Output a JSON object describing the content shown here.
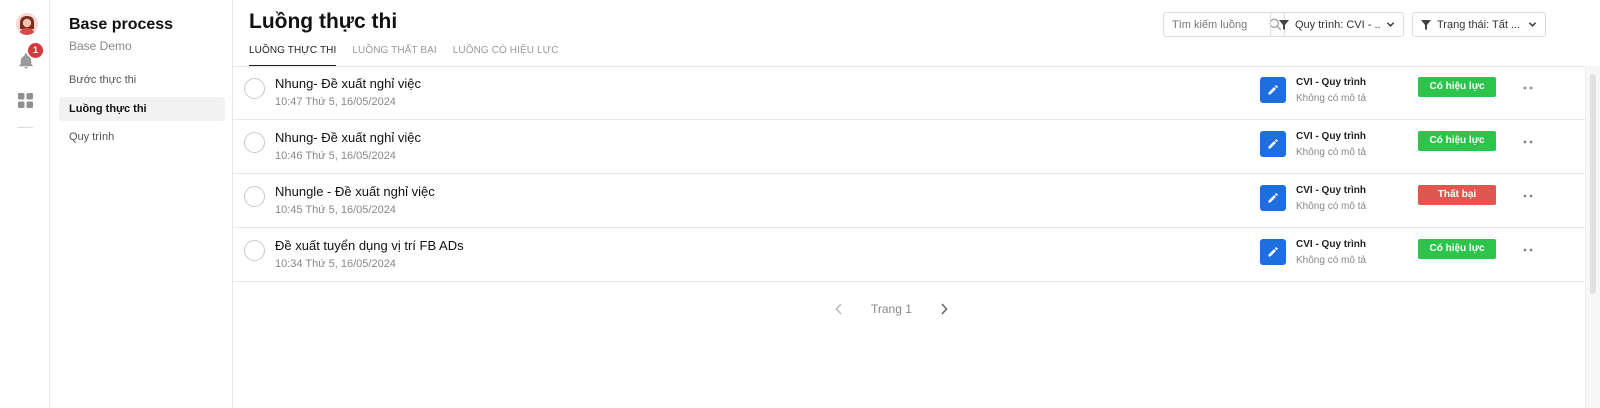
{
  "rail": {
    "notification_count": "1",
    "colors": {
      "badge": "#d9363e"
    }
  },
  "sidebar": {
    "title": "Base process",
    "subtitle": "Base Demo",
    "items": [
      {
        "label": "Bước thực thi",
        "active": false
      },
      {
        "label": "Luồng thực thi",
        "active": true
      },
      {
        "label": "Quy trình",
        "active": false
      }
    ]
  },
  "main": {
    "title": "Luồng thực thi",
    "tabs": [
      {
        "label": "LUỒNG THỰC THI",
        "active": true
      },
      {
        "label": "LUỒNG THẤT BẠI",
        "active": false
      },
      {
        "label": "LUỒNG CÓ HIỆU LỰC",
        "active": false
      }
    ],
    "search": {
      "placeholder": "Tìm kiếm luồng",
      "value": ""
    },
    "filters": {
      "process": "Quy trình: CVI - ...",
      "status": "Trạng thái: Tất ..."
    },
    "rows": [
      {
        "title": "Nhung- Đề xuất nghỉ việc",
        "time": "10:47 Thứ 5, 16/05/2024",
        "process": "CVI - Quy trình",
        "description": "Không có mô tả",
        "status": "Có hiệu lực",
        "status_type": "ok"
      },
      {
        "title": "Nhung- Đề xuất nghỉ việc",
        "time": "10:46 Thứ 5, 16/05/2024",
        "process": "CVI - Quy trình",
        "description": "Không có mô tả",
        "status": "Có hiệu lực",
        "status_type": "ok"
      },
      {
        "title": "Nhungle - Đề xuất nghỉ việc",
        "time": "10:45 Thứ 5, 16/05/2024",
        "process": "CVI - Quy trình",
        "description": "Không có mô tả",
        "status": "Thất bại",
        "status_type": "fail"
      },
      {
        "title": "Đề xuất tuyển dụng vị trí FB ADs",
        "time": "10:34 Thứ 5, 16/05/2024",
        "process": "CVI - Quy trình",
        "description": "Không có mô tả",
        "status": "Có hiệu lực",
        "status_type": "ok"
      }
    ],
    "pagination": {
      "label": "Trang 1"
    },
    "colors": {
      "success": "#2cc44b",
      "failure": "#e0574f",
      "edit": "#1d6fe0"
    },
    "icons": [
      "search-icon",
      "filter-icon",
      "chevron-down-icon",
      "pencil-icon",
      "more-icon",
      "chevron-left-icon",
      "chevron-right-icon"
    ]
  }
}
